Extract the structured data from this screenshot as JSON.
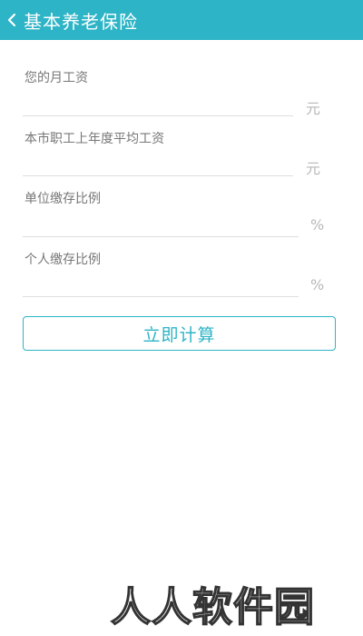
{
  "header": {
    "title": "基本养老保险"
  },
  "fields": [
    {
      "label": "您的月工资",
      "value": "",
      "unit": "元"
    },
    {
      "label": "本市职工上年度平均工资",
      "value": "",
      "unit": "元"
    },
    {
      "label": "单位缴存比例",
      "value": "",
      "unit": "%"
    },
    {
      "label": "个人缴存比例",
      "value": "",
      "unit": "%"
    }
  ],
  "calculate_button": "立即计算",
  "watermark": "人人软件园",
  "colors": {
    "accent": "#2db4c6",
    "label": "#777777",
    "unit": "#b8b8b8",
    "divider": "#dedede"
  },
  "icons": {
    "back": "chevron-left-icon"
  }
}
